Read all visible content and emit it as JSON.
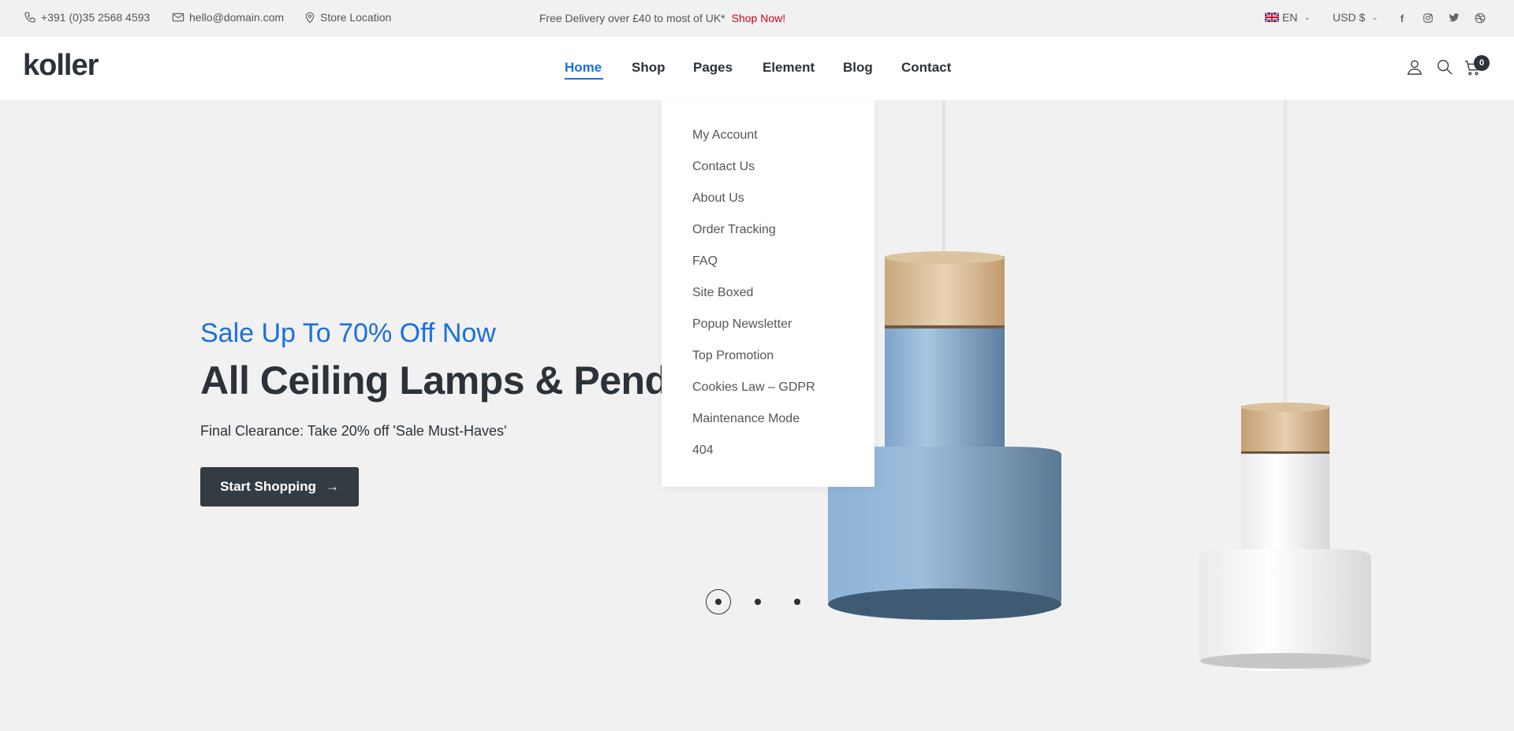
{
  "topbar": {
    "phone": "+391 (0)35 2568 4593",
    "email": "hello@domain.com",
    "store": "Store Location",
    "promo_text": "Free Delivery over £40 to most of UK*",
    "promo_link": "Shop Now!",
    "language": "EN",
    "currency": "USD $",
    "social_icons": [
      "facebook-icon",
      "instagram-icon",
      "twitter-icon",
      "dribbble-icon"
    ]
  },
  "header": {
    "logo": "koller",
    "nav": [
      "Home",
      "Shop",
      "Pages",
      "Element",
      "Blog",
      "Contact"
    ],
    "active_nav": "Home",
    "cart_count": "0"
  },
  "dropdown": {
    "items": [
      "My Account",
      "Contact Us",
      "About Us",
      "Order Tracking",
      "FAQ",
      "Site Boxed",
      "Popup Newsletter",
      "Top Promotion",
      "Cookies Law – GDPR",
      "Maintenance Mode",
      "404"
    ]
  },
  "hero": {
    "kicker": "Sale Up To 70% Off Now",
    "title": "All Ceiling Lamps & Pendants",
    "subtitle": "Final Clearance: Take 20% off 'Sale Must-Haves'",
    "cta": "Start Shopping",
    "slides": 3,
    "active_slide": 1
  },
  "colors": {
    "accent": "#1b6fe0",
    "promo_link": "#d0021b",
    "dark": "#2b3239",
    "background": "#f1f1f1"
  }
}
